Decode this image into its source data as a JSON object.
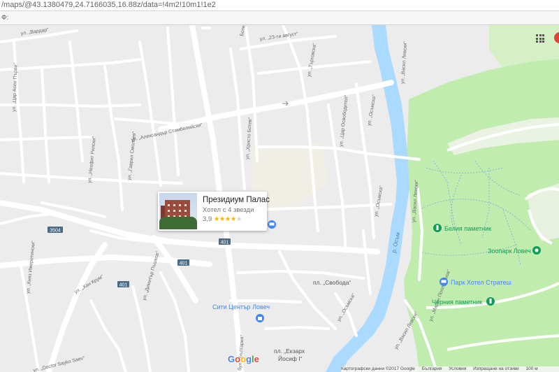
{
  "browser": {
    "url": "/maps/@43.1380479,24.7166035,16.88z/data=!4m2!10m1!1e2",
    "bookmark_label": "Ф:"
  },
  "colors": {
    "water": "#aadaff",
    "park": "#c0ecae",
    "park_light": "#d5f0c5",
    "road": "#ffffff",
    "road_label": "#6a6a6a",
    "poi_blue": "#4285f4",
    "poi_green": "#0f9d58",
    "route_shield": "#4a6b86",
    "star": "#f4b400"
  },
  "street_labels": {
    "vardar": "ул. „Вардар“",
    "tsar_asen": "ул. „Цар Асен Първи“",
    "aleksandar": "ул. „Александър Стамболийски“",
    "neofit": "ул. „Неофит Рилски“",
    "gavril": "ул. „Гаврил Смолеев“",
    "hristo": "ул. „Христо Ботев“",
    "botev_top": "Ботев",
    "aug23": "ул. „23-ти август“",
    "gurko": "ул. „Търговска“",
    "tsar_osv": "ул. „Цар Освободител“",
    "osmaska_top": "ул. „Осъмска“",
    "vasil_top": "ул. „Васил Левски“",
    "vasil_mid": "ул. „Васил Левски“",
    "vasil_bottom": "ул. „Васил Левски“",
    "osmaska_mid": "ул. „Осъмска“",
    "osmaska_low": "ул. „Осъмска“",
    "knyaz": "ул. „Княз Имеретински“",
    "han_krum": "ул. „Хан Крум“",
    "dimitar": "ул. „Димитър Пъшков“",
    "bul_bulgaria": "бул. „България“",
    "doctor": "ул. „Doctor Sayko Saev“",
    "marin": "ул. „Марин Поплуканов“",
    "river": "р. Осъм"
  },
  "route_shields": {
    "r3504": "3504",
    "r401a": "401",
    "r401b": "401",
    "r401c": "401"
  },
  "places": {
    "svoboda": "пл. „Свобода“",
    "city_center": "Сити Център Ловеч",
    "ekzarh_line1": "пл. „Екзарх",
    "ekzarh_line2": "Йосиф I“",
    "beliya": "Белия паметник",
    "zoo": "Зоопарк Ловеч",
    "park_hotel": "Парк Хотел Стратеш",
    "cherniya": "Черния паметник"
  },
  "hotel_card": {
    "name": "Президиум Палас",
    "type": "Хотел с 4 звезди",
    "rating": "3,9",
    "stars": "★★★★",
    "stars_empty": "★",
    "star_value": 3.9
  },
  "brand": {
    "G": "G",
    "o1": "o",
    "o2": "o",
    "g": "g",
    "l": "l",
    "e": "e"
  },
  "footer": {
    "map_data": "Картографски данни ©2017 Google",
    "country": "България",
    "terms": "Условия",
    "feedback": "Изпращане на отзиви",
    "scale": "100 м"
  }
}
